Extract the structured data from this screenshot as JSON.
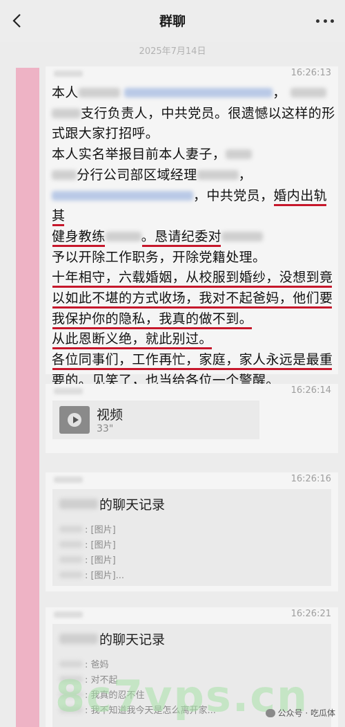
{
  "header": {
    "title": "群聊"
  },
  "date": "2025年7月14日",
  "messages": [
    {
      "time": "16:26:13",
      "p1": {
        "a": "本人",
        "b": "，",
        "c": "支行负责人，中共党员。很遗憾以这样的形式跟大家打招呼。"
      },
      "p2": {
        "a": "本人实名举报目前本人妻子，",
        "b": "分行公司部区域经理",
        "c": "，中共党员，",
        "d": "婚内出轨其",
        "e": "健身教练",
        "f": "。恳请纪委对",
        "g": "予以开除工作职务，开除党籍处理。"
      },
      "p3": {
        "a": "十年相守，六载婚姻，从校服到婚纱，没想到竟以如此不堪的方式收场，我对不起爸妈，他们要我保护你的隐私，我真的做不到。"
      },
      "p4": "从此恩断义绝，就此别过。",
      "p5": "各位同事们，工作再忙，家庭，家人永远是最重要的。见笑了，也当给各位一个警醒。"
    },
    {
      "time": "16:26:14",
      "video_label": "视频",
      "video_duration": "33\""
    },
    {
      "time": "16:26:16",
      "chat_title": "的聊天记录",
      "lines": [
        ": [图片]",
        ": [图片]",
        ": [图片]",
        ": [图片]..."
      ]
    },
    {
      "time": "16:26:21",
      "chat_title": "的聊天记录",
      "lines": [
        ": 爸妈",
        ": 对不起",
        ": 我真的忍不住",
        ": 我不知道我今天是怎么离开家..."
      ]
    }
  ],
  "watermark": "8c7vps.cn",
  "wechat_mark": "公众号 · 吃瓜体",
  "icons": {
    "back": "chevron-left-icon",
    "more": "more-dots-icon",
    "play": "play-icon"
  },
  "colors": {
    "accent_pink": "#eeb3c5",
    "underline_red": "#c6172b"
  }
}
